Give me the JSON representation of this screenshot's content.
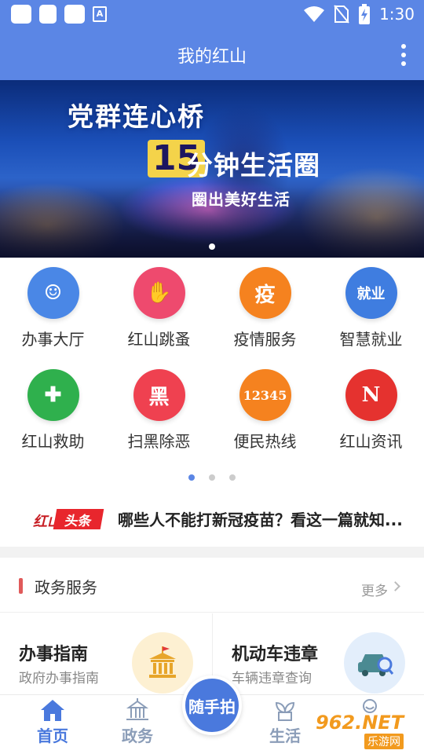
{
  "status_bar": {
    "time": "1:30",
    "icons": [
      "notification-icon",
      "notification-icon",
      "notification-icon",
      "accessibility-icon",
      "wifi-icon",
      "no-sim-icon",
      "battery-charging-icon"
    ]
  },
  "app_bar": {
    "title": "我的红山",
    "more_icon": "more-vertical-icon",
    "color": "#5b86e5"
  },
  "banner": {
    "title": "党群连心桥",
    "number": "15",
    "subtitle": "分钟生活圈",
    "tagline": "圈出美好生活",
    "active_slide": 1,
    "slide_count": 1
  },
  "quick_menu": [
    {
      "label": "办事大厅",
      "icon": "service-hall-icon",
      "color": "#4a87e6",
      "glyph": "☺"
    },
    {
      "label": "红山跳蚤",
      "icon": "handshake-icon",
      "color": "#ee4a6e",
      "glyph": "✋"
    },
    {
      "label": "疫情服务",
      "icon": "epidemic-icon",
      "color": "#f5821f",
      "glyph": "疫"
    },
    {
      "label": "智慧就业",
      "icon": "employment-icon",
      "color": "#3f7de0",
      "glyph": "就业"
    },
    {
      "label": "红山救助",
      "icon": "relief-icon",
      "color": "#2fb04d",
      "glyph": "✚"
    },
    {
      "label": "扫黑除恶",
      "icon": "anti-crime-icon",
      "color": "#ef4150",
      "glyph": "黑"
    },
    {
      "label": "便民热线",
      "icon": "hotline-icon",
      "color": "#f5821f",
      "glyph": "12345"
    },
    {
      "label": "红山资讯",
      "icon": "news-icon",
      "color": "#e5322f",
      "glyph": "N"
    }
  ],
  "quick_menu_pager": {
    "pages": 3,
    "active": 1
  },
  "headline": {
    "logo_text": "红山",
    "logo_tag": "头条",
    "text": "哪些人不能打新冠疫苗？看这一篇就知..."
  },
  "gov_section": {
    "title": "政务服务",
    "more_label": "更多",
    "cards": [
      {
        "title": "办事指南",
        "subtitle": "政府办事指南",
        "icon": "government-building-icon",
        "bg": "#fdf0d2"
      },
      {
        "title": "机动车违章",
        "subtitle": "车辆违章查询",
        "icon": "car-search-icon",
        "bg": "#e3eefb"
      }
    ]
  },
  "bottom_nav": {
    "items": [
      {
        "label": "首页",
        "icon": "home-icon",
        "active": true
      },
      {
        "label": "政务",
        "icon": "government-icon",
        "active": false
      },
      {
        "label": "生活",
        "icon": "sprout-icon",
        "active": false
      },
      {
        "label": "",
        "icon": "profile-icon",
        "active": false
      }
    ],
    "fab_label": "随手拍"
  },
  "watermark": {
    "site": "962.NET",
    "sub": "乐游网"
  }
}
